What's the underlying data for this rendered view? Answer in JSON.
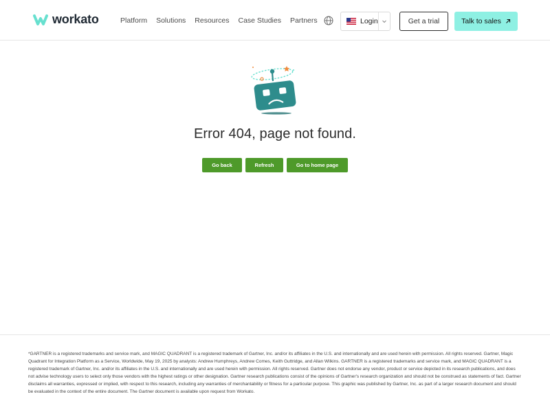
{
  "header": {
    "brand": "workato",
    "nav": [
      "Platform",
      "Solutions",
      "Resources",
      "Case Studies",
      "Partners"
    ],
    "login_label": "Login",
    "trial_label": "Get a trial",
    "sales_label": "Talk to sales"
  },
  "main": {
    "title": "Error 404, page not found.",
    "buttons": [
      "Go back",
      "Refresh",
      "Go to home page"
    ]
  },
  "footer": {
    "disclaimer": "*GARTNER is a registered trademarks and service mark, and MAGIC QUADRANT is a registered trademark of Gartner, Inc. and/or its affiliates in the U.S. and internationally and are used herein with permission. All rights reserved. Gartner, Magic Quadrant for Integration Platform as a Service, Worldwide, May 19, 2025 by analysts: Andrew Humphreys, Andrew Comes, Keith Guttridge, and Allan Wilkins. GARTNER is a registered trademarks and service mark, and MAGIC QUADRANT is a registered trademark of Gartner, Inc. and/or its affiliates in the U.S. and internationally and are used herein with permission. All rights reserved. Gartner does not endorse any vendor, product or service depicted in its research publications, and does not advise technology users to select only those vendors with the highest ratings or other designation. Gartner research publications consist of the opinions of Gartner's research organization and should not be construed as statements of fact. Gartner disclaims all warranties, expressed or implied, with respect to this research, including any warranties of merchantability or fitness for a particular purpose. This graphic was published by Gartner, Inc. as part of a larger research document and should be evaluated in the context of the entire document. The Gartner document is available upon request from Workato."
  },
  "colors": {
    "accent_teal": "#67e0cf",
    "cta_mint": "#8ef0e3",
    "robot_teal": "#2e8c8c",
    "button_green": "#4e9a2a"
  },
  "icons": [
    "workato-logo-icon",
    "globe-icon",
    "us-flag-icon",
    "chevron-down-icon",
    "arrow-up-right-icon",
    "robot-illustration"
  ]
}
